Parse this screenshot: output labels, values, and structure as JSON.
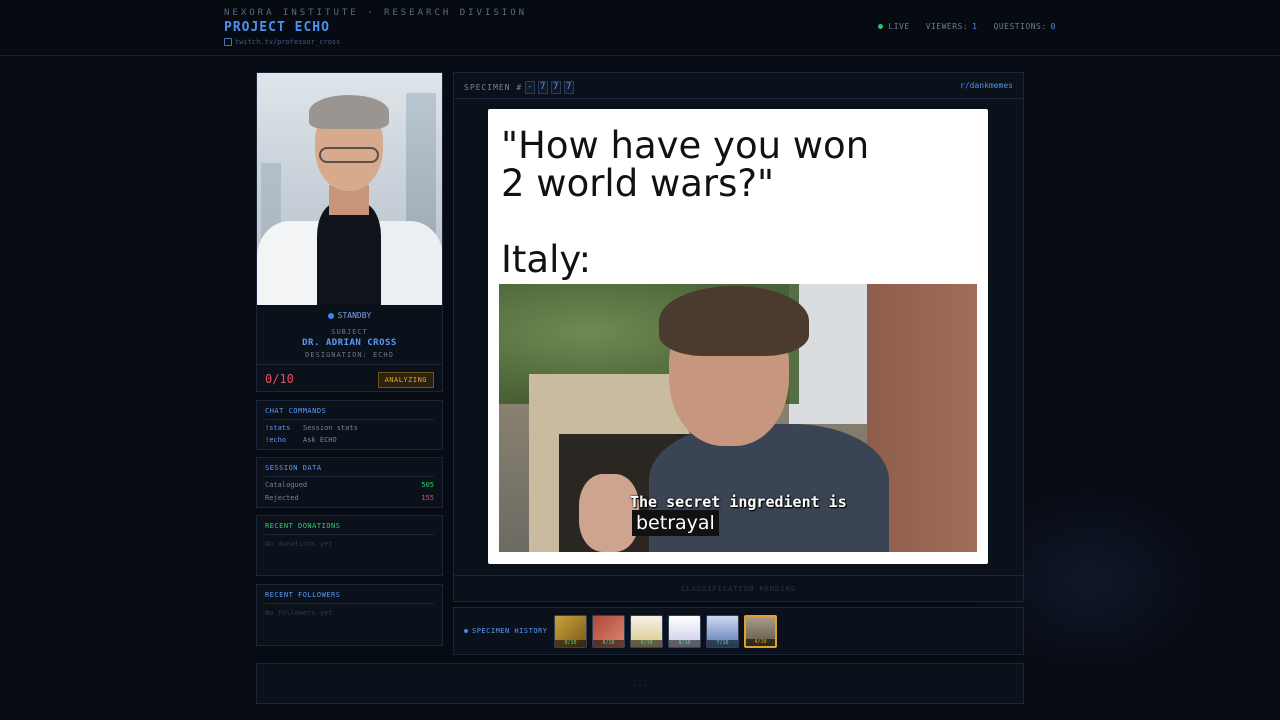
{
  "header": {
    "subtitle": "NEXORA INSTITUTE · RESEARCH DIVISION",
    "title": "PROJECT ECHO",
    "link": "twitch.tv/professor_cross",
    "live_label": "LIVE",
    "viewers_label": "VIEWERS:",
    "viewers_value": "1",
    "questions_label": "QUESTIONS:",
    "questions_value": "0"
  },
  "profile": {
    "status": "STANDBY",
    "subject_label": "SUBJECT",
    "name": "DR. ADRIAN CROSS",
    "designation": "DESIGNATION: ECHO",
    "score": "0/10",
    "state_badge": "ANALYZING"
  },
  "commands": {
    "title": "CHAT COMMANDS",
    "items": [
      {
        "cmd": "!stats",
        "desc": "Session stats"
      },
      {
        "cmd": "!echo",
        "desc": "Ask ECHO"
      }
    ]
  },
  "session": {
    "title": "SESSION DATA",
    "rows": [
      {
        "key": "Catalogued",
        "value": "505",
        "color": "#2fcf6c"
      },
      {
        "key": "Rejected",
        "value": "155",
        "color": "#e84a5f"
      }
    ]
  },
  "donations": {
    "title": "RECENT DONATIONS",
    "empty": "No donations yet"
  },
  "followers": {
    "title": "RECENT FOLLOWERS",
    "empty": "No followers yet"
  },
  "specimen": {
    "label": "SPECIMEN #",
    "digits": [
      "-",
      "7",
      "7",
      "7"
    ],
    "subreddit": "r/dankmemes",
    "meme_line1": "\"How have you won",
    "meme_line2": "2 world wars?\"",
    "meme_line3": "Italy:",
    "caption1": "The secret ingredient is",
    "caption2": "betrayal",
    "footer": "CLASSIFICATION PENDING"
  },
  "history": {
    "label": "SPECIMEN HISTORY",
    "thumbs": [
      {
        "score": "0/10",
        "color": "#c9a23a"
      },
      {
        "score": "6/10",
        "color": "#b0473c"
      },
      {
        "score": "0/10",
        "color": "#d8c98a"
      },
      {
        "score": "8/10",
        "color": "#e9e9ee"
      },
      {
        "score": "7/10",
        "color": "#5a79b8"
      },
      {
        "score": "4/10",
        "color": "#8a8070"
      }
    ]
  },
  "footer_bar": {
    "text": "..."
  }
}
